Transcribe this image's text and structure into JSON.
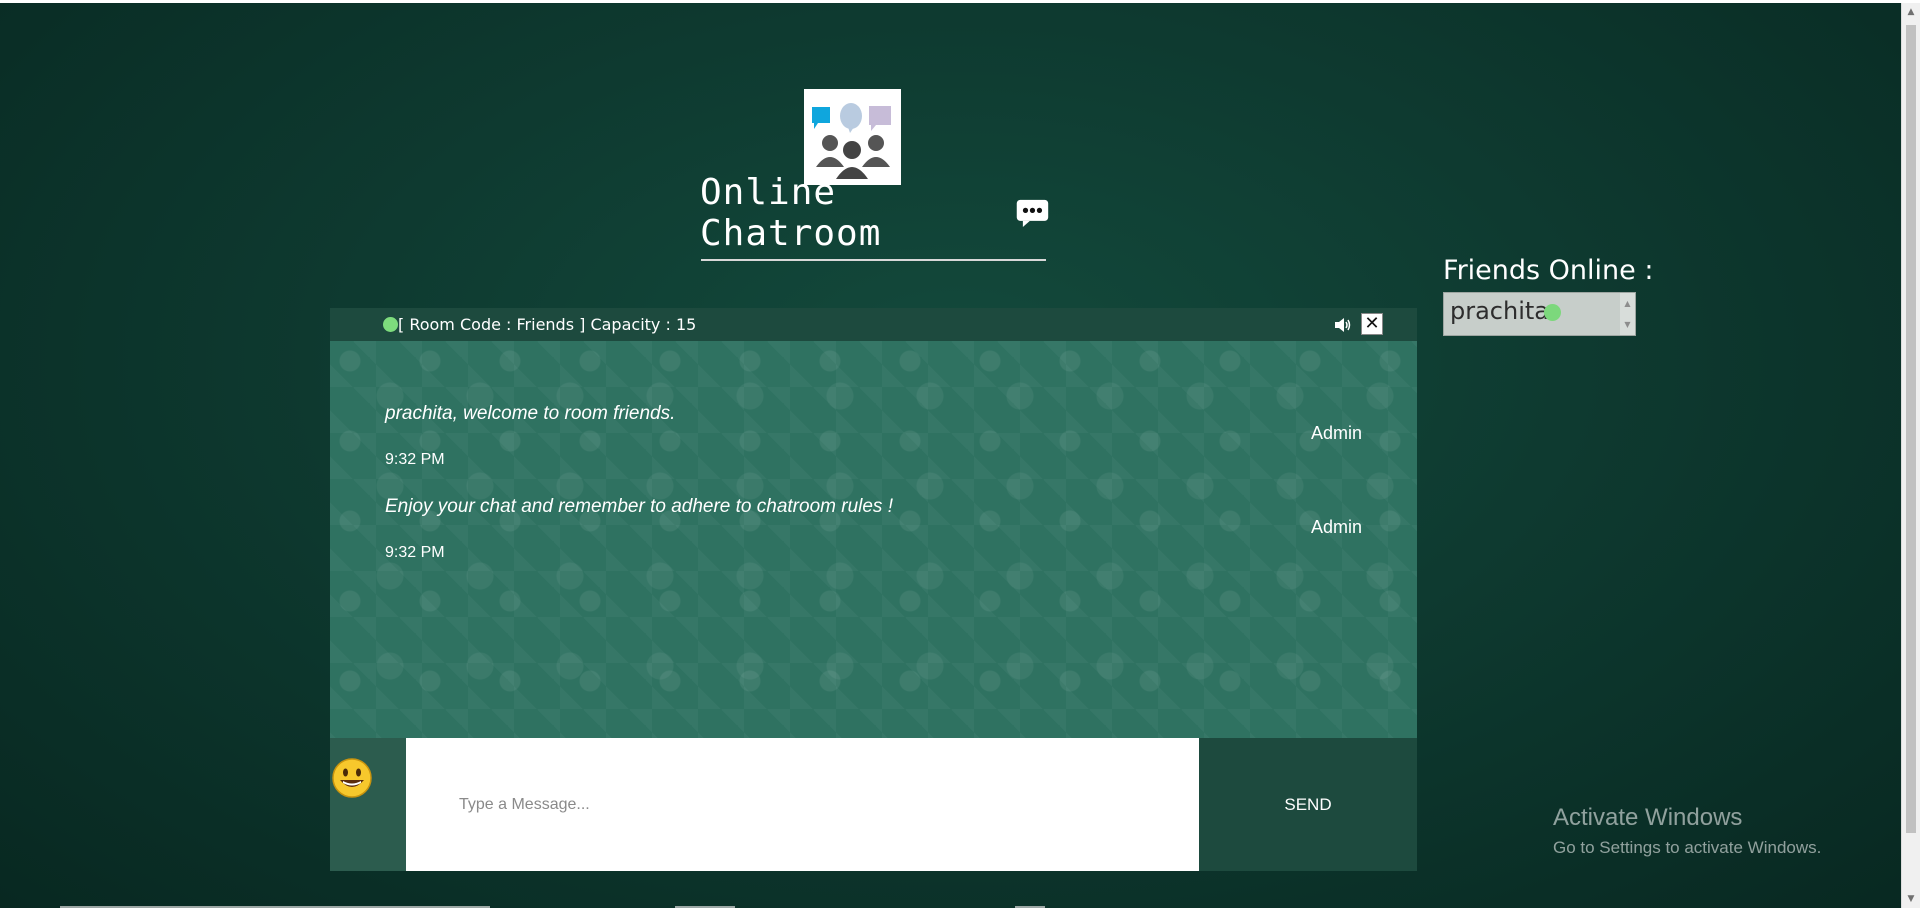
{
  "header": {
    "title": "Online Chatroom",
    "logo_icon": "group-chat-icon",
    "title_icon": "speech-bubble-icon"
  },
  "room": {
    "info": "[ Room Code : Friends ] Capacity : 15",
    "status_color": "#7ddc7d"
  },
  "messages": [
    {
      "text": "prachita, welcome to room friends.",
      "time": "9:32 PM",
      "sender": "Admin"
    },
    {
      "text": "Enjoy your chat and remember to adhere to chatroom rules !",
      "time": "9:32 PM",
      "sender": "Admin"
    }
  ],
  "composer": {
    "placeholder": "Type a Message...",
    "send_label": "SEND",
    "emoji_icon": "smiley-emoji-icon"
  },
  "friends": {
    "title": "Friends Online :",
    "list": [
      {
        "name": "prachita",
        "online": true
      }
    ]
  },
  "watermark": {
    "title": "Activate Windows",
    "subtitle": "Go to Settings to activate Windows."
  },
  "colors": {
    "background": "#0e3a30",
    "header_bar": "#1d4a3e",
    "chat_body": "#2f7261",
    "online_dot": "#7ddc7d"
  }
}
